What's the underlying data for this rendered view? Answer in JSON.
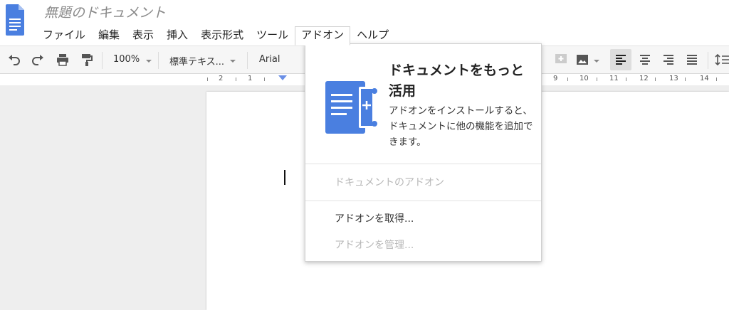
{
  "document": {
    "title": "無題のドキュメント"
  },
  "menubar": {
    "items": [
      "ファイル",
      "編集",
      "表示",
      "挿入",
      "表示形式",
      "ツール",
      "アドオン",
      "ヘルプ"
    ],
    "open_menu": "アドオン"
  },
  "toolbar": {
    "zoom": "100%",
    "style": "標準テキス...",
    "font": "Arial"
  },
  "ruler": {
    "numbers": [
      "2",
      "1",
      "9",
      "10",
      "11",
      "12",
      "13",
      "14"
    ]
  },
  "addons_menu": {
    "promo_title": "ドキュメントをもっと活用",
    "promo_description": "アドオンをインストールすると、ドキュメントに他の機能を追加できます。",
    "doc_addons_label": "ドキュメントのアドオン",
    "get_addons_label": "アドオンを取得...",
    "manage_addons_label": "アドオンを管理..."
  },
  "colors": {
    "docs_blue": "#4a7fe0",
    "accent": "#6b8fe6"
  }
}
